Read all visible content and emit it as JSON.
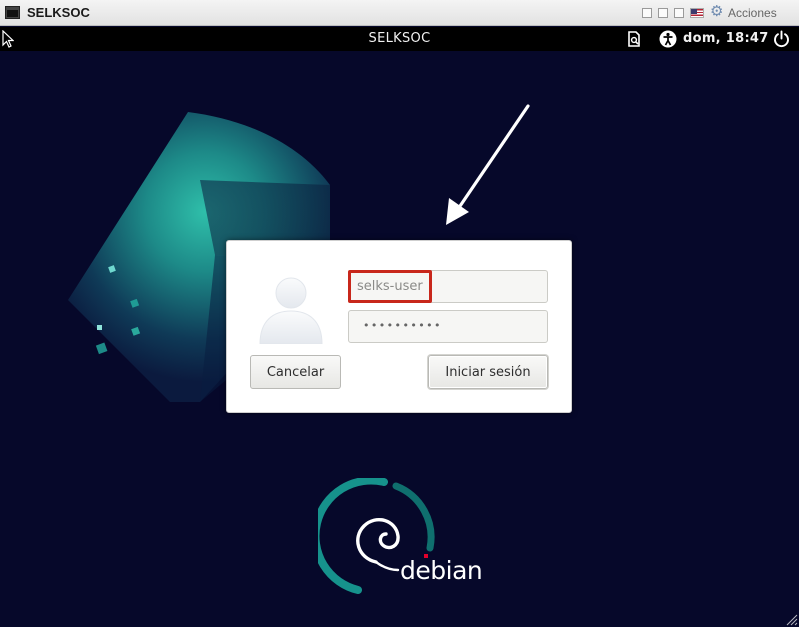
{
  "window": {
    "title": "SELKSOC",
    "actions_label": "Acciones",
    "actions_icon": "gear-icon",
    "controls": [
      "minimize",
      "restore",
      "maximize",
      "keyboard-layout-flag"
    ]
  },
  "topbar": {
    "title": "SELKSOC",
    "clock": "dom, 18:47",
    "icons": [
      "pointer-cursor-icon",
      "document-icon",
      "accessibility-icon",
      "power-icon"
    ]
  },
  "login": {
    "username_value": "selks-user",
    "password_mask": "••••••••••",
    "cancel_label": "Cancelar",
    "submit_label": "Iniciar sesión",
    "avatar_icon": "user-avatar-icon"
  },
  "branding": {
    "logo_text": "debian"
  },
  "colors": {
    "background": "#06082a",
    "accent_teal": "#1f9c95",
    "highlight": "#c8271b",
    "topbar": "#000000"
  }
}
